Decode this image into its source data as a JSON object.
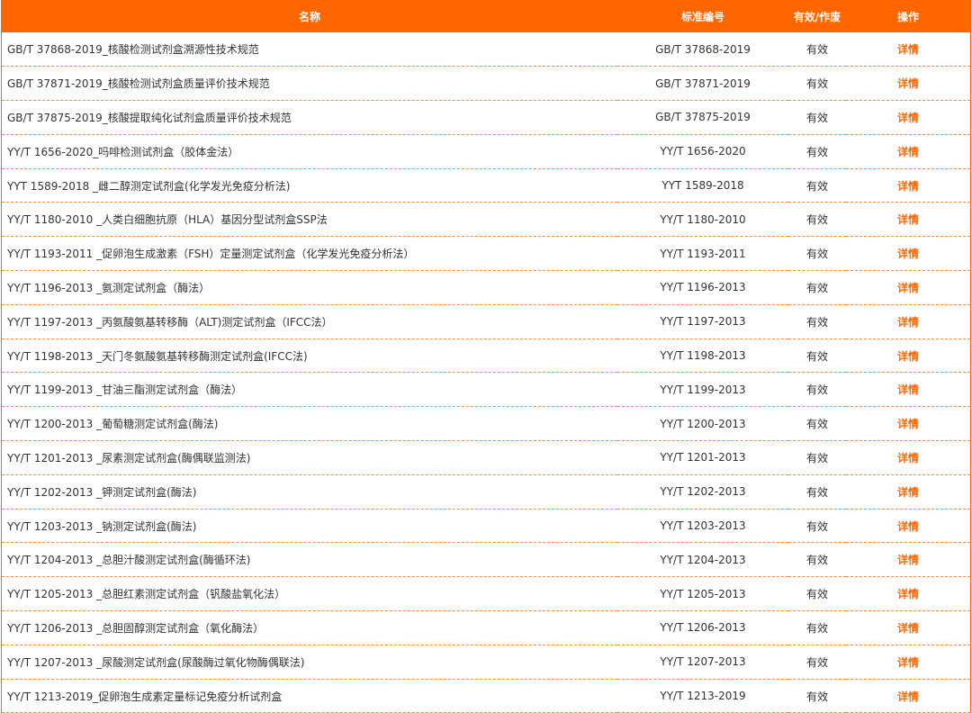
{
  "colors": {
    "header_bg": "#ff6600",
    "link": "#ff6600",
    "divider": "#ff8a3d"
  },
  "header": {
    "name": "名称",
    "std_no": "标准编号",
    "status": "有效/作废",
    "action": "操作"
  },
  "rows": [
    {
      "name": "GB/T 37868-2019_核酸检测试剂盒溯源性技术规范",
      "std": "GB/T 37868-2019",
      "status": "有效",
      "action": "详情"
    },
    {
      "name": "GB/T 37871-2019_核酸检测试剂盒质量评价技术规范",
      "std": "GB/T 37871-2019",
      "status": "有效",
      "action": "详情"
    },
    {
      "name": "GB/T 37875-2019_核酸提取纯化试剂盒质量评价技术规范",
      "std": "GB/T 37875-2019",
      "status": "有效",
      "action": "详情"
    },
    {
      "name": "YY/T 1656-2020_吗啡检测试剂盒（胶体金法）",
      "std": "YY/T 1656-2020",
      "status": "有效",
      "action": "详情"
    },
    {
      "name": "YYT 1589-2018 _雌二醇测定试剂盒(化学发光免疫分析法)",
      "std": "YYT 1589-2018",
      "status": "有效",
      "action": "详情"
    },
    {
      "name": "YY/T 1180-2010 _人类白细胞抗原（HLA）基因分型试剂盒SSP法",
      "std": "YY/T 1180-2010",
      "status": "有效",
      "action": "详情"
    },
    {
      "name": "YY/T 1193-2011 _促卵泡生成激素（FSH）定量测定试剂盒（化学发光免疫分析法）",
      "std": "YY/T 1193-2011",
      "status": "有效",
      "action": "详情"
    },
    {
      "name": "YY/T 1196-2013 _氨测定试剂盒（酶法）",
      "std": "YY/T 1196-2013",
      "status": "有效",
      "action": "详情"
    },
    {
      "name": "YY/T 1197-2013 _丙氨酸氨基转移酶（ALT)测定试剂盒（IFCC法）",
      "std": "YY/T 1197-2013",
      "status": "有效",
      "action": "详情"
    },
    {
      "name": "YY/T 1198-2013 _天门冬氨酸氨基转移酶测定试剂盒(IFCC法)",
      "std": "YY/T 1198-2013",
      "status": "有效",
      "action": "详情"
    },
    {
      "name": "YY/T 1199-2013 _甘油三酯测定试剂盒（酶法）",
      "std": "YY/T 1199-2013",
      "status": "有效",
      "action": "详情"
    },
    {
      "name": "YY/T 1200-2013 _葡萄糖测定试剂盒(酶法)",
      "std": "YY/T 1200-2013",
      "status": "有效",
      "action": "详情"
    },
    {
      "name": "YY/T 1201-2013 _尿素测定试剂盒(酶偶联监测法)",
      "std": "YY/T 1201-2013",
      "status": "有效",
      "action": "详情"
    },
    {
      "name": "YY/T 1202-2013 _钾测定试剂盒(酶法)",
      "std": "YY/T 1202-2013",
      "status": "有效",
      "action": "详情"
    },
    {
      "name": "YY/T 1203-2013 _钠测定试剂盒(酶法)",
      "std": "YY/T 1203-2013",
      "status": "有效",
      "action": "详情"
    },
    {
      "name": "YY/T 1204-2013 _总胆汁酸测定试剂盒(酶循环法)",
      "std": "YY/T 1204-2013",
      "status": "有效",
      "action": "详情"
    },
    {
      "name": "YY/T 1205-2013 _总胆红素测定试剂盒（钒酸盐氧化法）",
      "std": "YY/T 1205-2013",
      "status": "有效",
      "action": "详情"
    },
    {
      "name": "YY/T 1206-2013 _总胆固醇测定试剂盒（氧化酶法）",
      "std": "YY/T 1206-2013",
      "status": "有效",
      "action": "详情"
    },
    {
      "name": "YY/T 1207-2013 _尿酸测定试剂盒(尿酸酶过氧化物酶偶联法)",
      "std": "YY/T 1207-2013",
      "status": "有效",
      "action": "详情"
    },
    {
      "name": "YY/T 1213-2019_促卵泡生成素定量标记免疫分析试剂盒",
      "std": "YY/T 1213-2019",
      "status": "有效",
      "action": "详情"
    }
  ]
}
